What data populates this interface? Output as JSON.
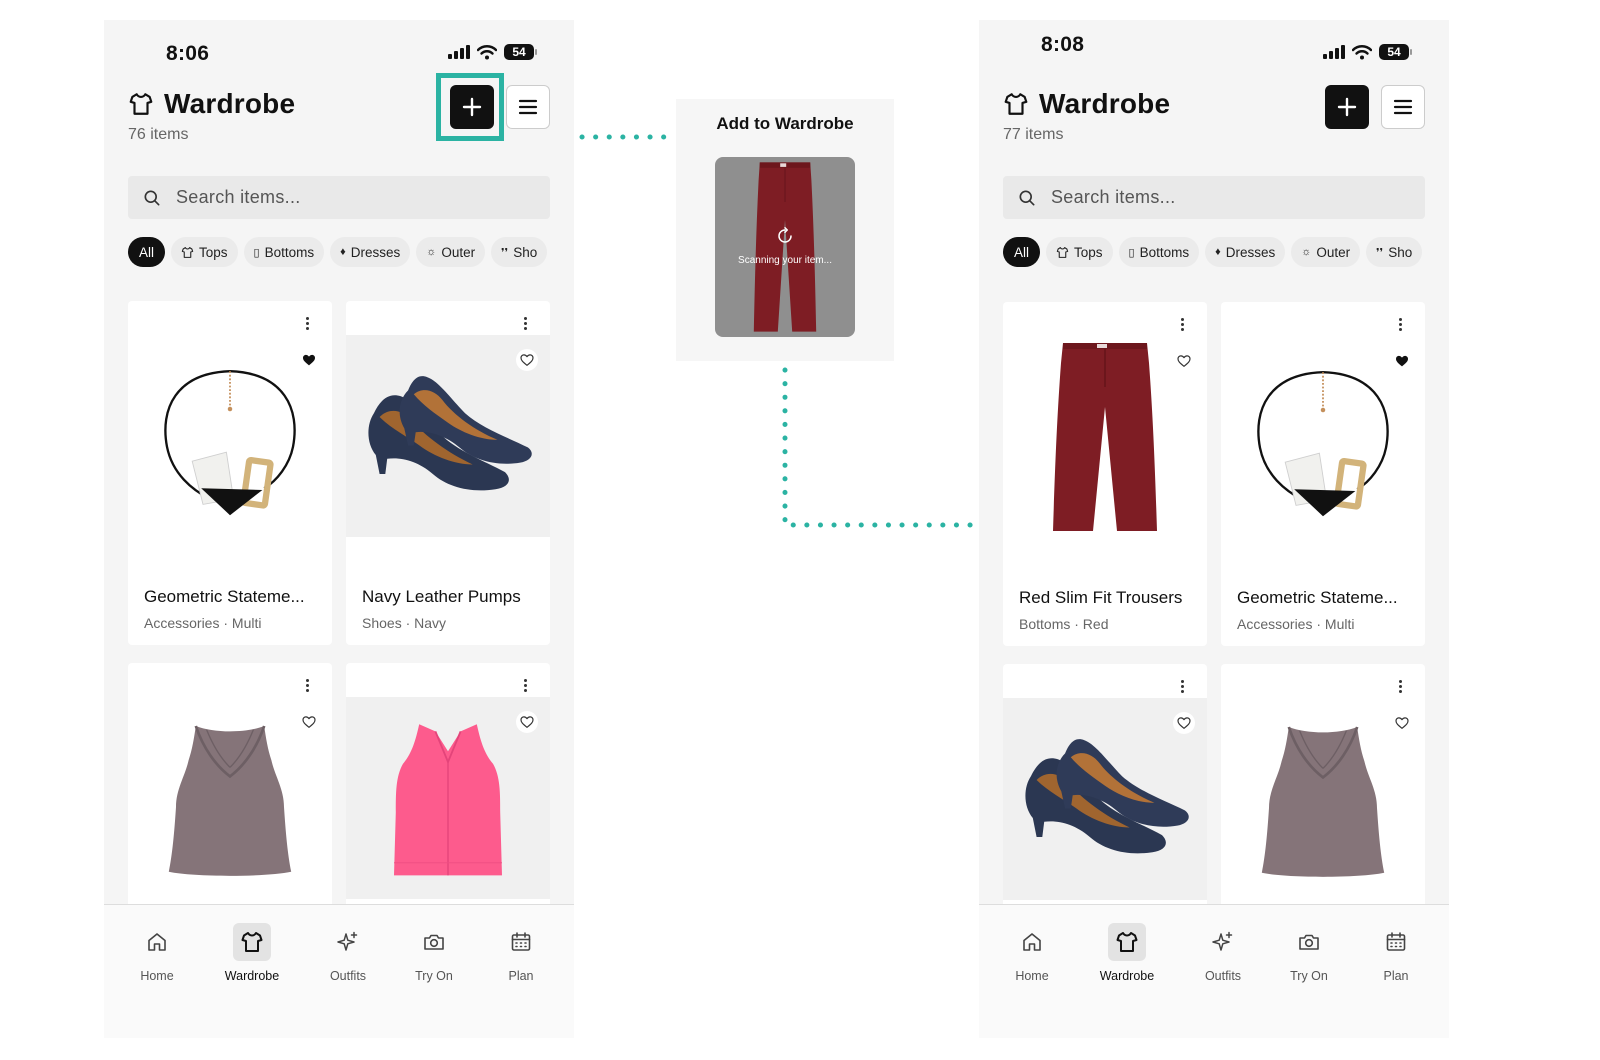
{
  "left_screen": {
    "status_time": "8:06",
    "battery": "54",
    "title": "Wardrobe",
    "item_count": "76 items",
    "search_placeholder": "Search items...",
    "chips": [
      "All",
      "Tops",
      "Bottoms",
      "Dresses",
      "Outer",
      "Sho"
    ],
    "cards": [
      {
        "name": "Geometric Stateme...",
        "meta": "Accessories · Multi",
        "favorited": true,
        "image": "necklace"
      },
      {
        "name": "Navy Leather Pumps",
        "meta": "Shoes · Navy",
        "favorited": false,
        "image": "pumps"
      },
      {
        "name": "",
        "meta": "",
        "favorited": false,
        "image": "mauve-top"
      },
      {
        "name": "",
        "meta": "",
        "favorited": false,
        "image": "pink-top"
      }
    ]
  },
  "modal": {
    "title": "Add to Wardrobe",
    "scanning_text": "Scanning your item..."
  },
  "right_screen": {
    "status_time": "8:08",
    "battery": "54",
    "title": "Wardrobe",
    "item_count": "77 items",
    "search_placeholder": "Search items...",
    "chips": [
      "All",
      "Tops",
      "Bottoms",
      "Dresses",
      "Outer",
      "Sho"
    ],
    "cards": [
      {
        "name": "Red Slim Fit Trousers",
        "meta": "Bottoms · Red",
        "favorited": false,
        "image": "red-trousers"
      },
      {
        "name": "Geometric Stateme...",
        "meta": "Accessories · Multi",
        "favorited": true,
        "image": "necklace"
      },
      {
        "name": "",
        "meta": "",
        "favorited": false,
        "image": "pumps"
      },
      {
        "name": "",
        "meta": "",
        "favorited": false,
        "image": "mauve-top"
      }
    ]
  },
  "tabs": [
    "Home",
    "Wardrobe",
    "Outfits",
    "Try On",
    "Plan"
  ],
  "active_tab": "Wardrobe",
  "colors": {
    "accent_highlight": "#2bb3a3",
    "primary": "#111111",
    "background": "#f5f5f5"
  }
}
